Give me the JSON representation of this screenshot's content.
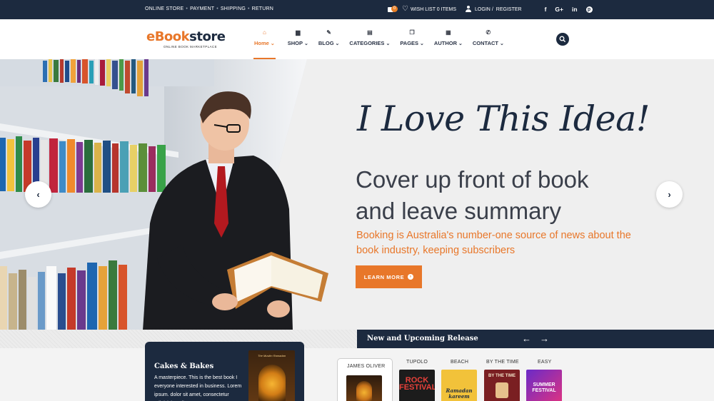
{
  "topbar": {
    "links": [
      "ONLINE STORE",
      "PAYMENT",
      "SHIPPING",
      "RETURN"
    ],
    "cart_count": "0",
    "wishlist": "WISH LIST 0 ITEMS",
    "login": "LOGIN",
    "register": "REGISTER",
    "socials": [
      "f",
      "G+",
      "in",
      "p"
    ]
  },
  "logo": {
    "word_start": "eBook",
    "word_end": "store",
    "tagline": "ONLINE BOOK MARKETPLACE"
  },
  "nav": {
    "items": [
      {
        "label": "Home",
        "icon": "home-icon"
      },
      {
        "label": "SHOP",
        "icon": "bag-icon"
      },
      {
        "label": "BLOG",
        "icon": "pencil-icon"
      },
      {
        "label": "CATEGORIES",
        "icon": "book-icon"
      },
      {
        "label": "PAGES",
        "icon": "copy-icon"
      },
      {
        "label": "AUTHOR",
        "icon": "document-icon"
      },
      {
        "label": "CONTACT",
        "icon": "phone-icon"
      }
    ],
    "active": "Home"
  },
  "hero": {
    "title": "I Love This Idea!",
    "subtitle_line1": "Cover up front of book",
    "subtitle_line2": "and leave summary",
    "description": "Booking is Australia's number-one source of news about the book industry, keeping subscribers",
    "button_label": "LEARN MORE",
    "prev": "‹",
    "next": "›"
  },
  "release": {
    "title": "New and Upcoming Release",
    "prev": "←",
    "next": "→"
  },
  "card": {
    "title": "Cakes & Bakes",
    "text": "A masterpiece. This is the best book I everyone interested in business. Lorem ipsum. dolor sit amet, consectetur adipisicing elit",
    "cover_title": "The Muslim Ramadan"
  },
  "authors": [
    "JAMES OLIVER",
    "TUPOLO",
    "BEACH",
    "BY THE TIME",
    "EASY"
  ],
  "books": [
    {
      "label": "ROCK FESTIVAL",
      "color": "#c8342c"
    },
    {
      "label": "Ramadan kareem",
      "color": "#f2c23a"
    },
    {
      "label": "BY THE TIME",
      "color": "#7a1f22"
    },
    {
      "label": "SUMMER FESTIVAL",
      "color": "#d6328c"
    }
  ],
  "colors": {
    "navy": "#1c2a3f",
    "accent": "#e8772a"
  }
}
